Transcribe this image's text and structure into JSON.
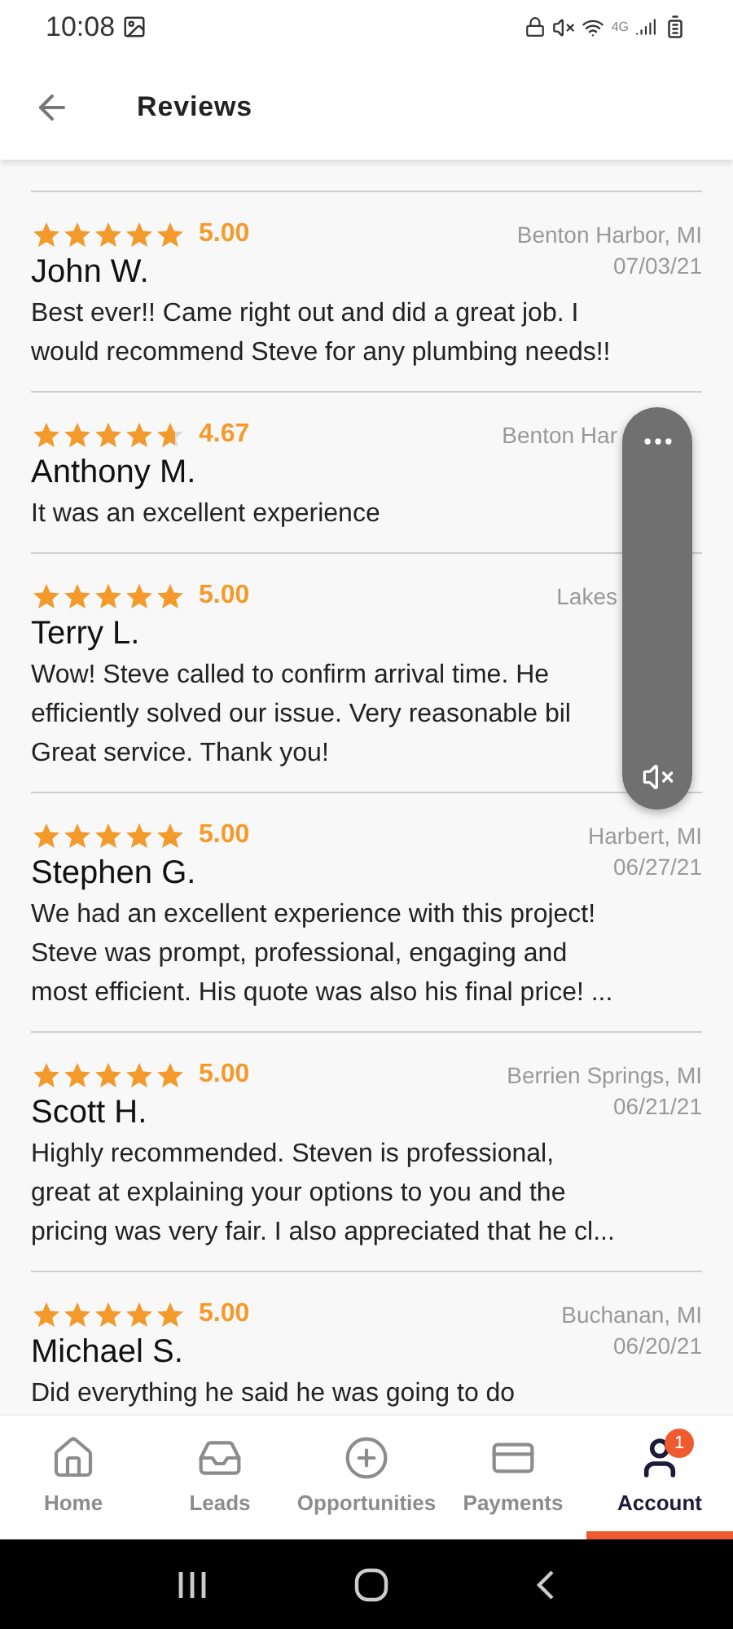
{
  "status_bar": {
    "time": "10:08",
    "network": "4G"
  },
  "header": {
    "title": "Reviews"
  },
  "reviews": [
    {
      "stars": 5,
      "rating": "5.00",
      "name": "John W.",
      "location": "Benton Harbor, MI",
      "date": "07/03/21",
      "lines": [
        "Best ever!! Came right out and did a great job. I",
        "would recommend Steve for any plumbing needs!!"
      ]
    },
    {
      "stars": 4.67,
      "rating": "4.67",
      "name": "Anthony M.",
      "location": "Benton Har",
      "overlaid": true,
      "lines": [
        "It was an excellent experience"
      ]
    },
    {
      "stars": 5,
      "rating": "5.00",
      "name": "Terry L.",
      "location": "Lakes",
      "overlaid": true,
      "lines": [
        "Wow! Steve called to confirm arrival time. He",
        "efficiently solved our issue. Very reasonable bil",
        "Great service. Thank you!"
      ]
    },
    {
      "stars": 5,
      "rating": "5.00",
      "name": "Stephen G.",
      "location": "Harbert, MI",
      "date": "06/27/21",
      "lines": [
        "We had an excellent experience with this project!",
        "Steve was prompt, professional, engaging and",
        "most efficient. His quote was also his final price! ..."
      ]
    },
    {
      "stars": 5,
      "rating": "5.00",
      "name": "Scott H.",
      "location": "Berrien Springs, MI",
      "date": "06/21/21",
      "lines": [
        "Highly recommended. Steven is professional,",
        "great at explaining your options to you and the",
        "pricing was very fair. I also appreciated that he cl..."
      ]
    },
    {
      "stars": 5,
      "rating": "5.00",
      "name": "Michael S.",
      "location": "Buchanan, MI",
      "date": "06/20/21",
      "lines": [
        "Did everything he said he was going to do"
      ]
    }
  ],
  "nav": [
    {
      "kind": "home",
      "label": "Home",
      "selected": false
    },
    {
      "kind": "leads",
      "label": "Leads",
      "selected": false
    },
    {
      "kind": "opportunities",
      "label": "Opportunities",
      "selected": false
    },
    {
      "kind": "payments",
      "label": "Payments",
      "selected": false
    },
    {
      "kind": "account",
      "label": "Account",
      "selected": true,
      "badge": "1"
    }
  ]
}
